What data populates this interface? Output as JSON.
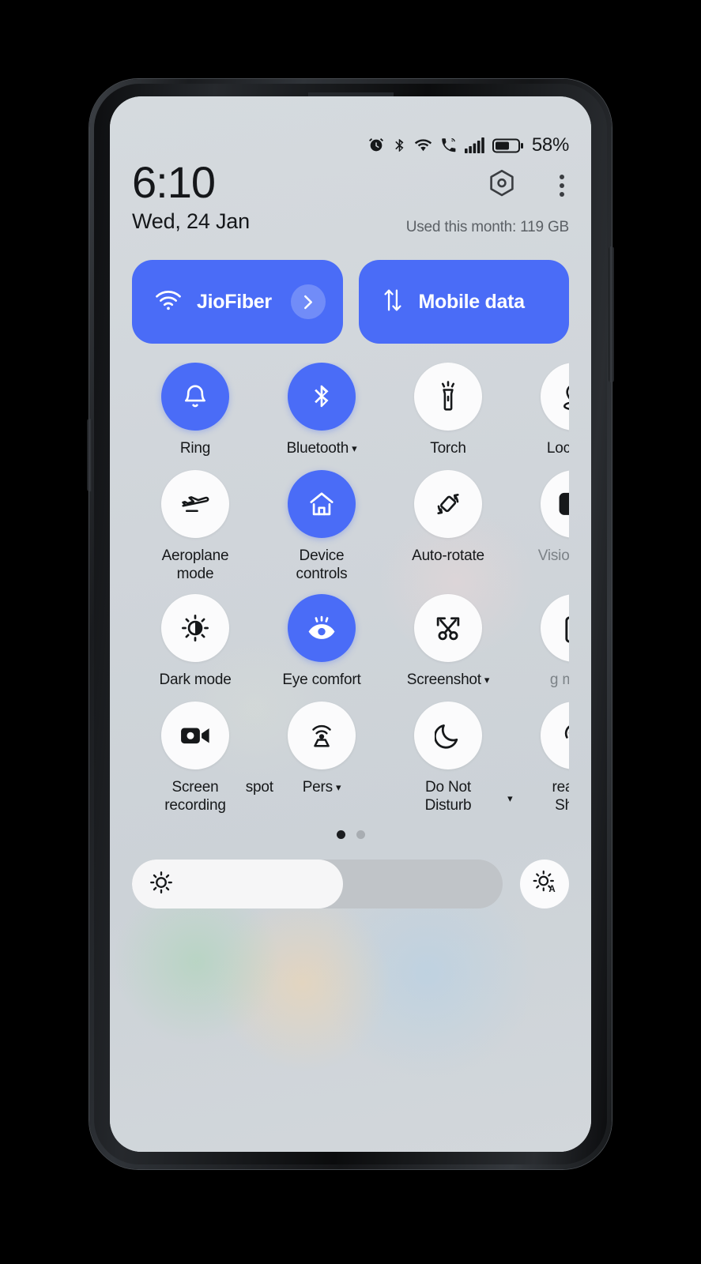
{
  "statusbar": {
    "icons": [
      "alarm-icon",
      "bluetooth-icon",
      "wifi-icon",
      "call-wifi-icon",
      "signal-icon",
      "battery-icon"
    ],
    "battery_percent": "58%"
  },
  "header": {
    "time": "6:10",
    "date": "Wed, 24 Jan",
    "settings_icon": "hex-gear-icon",
    "overflow_icon": "three-dot-menu-icon",
    "data_usage": "Used this month: 119 GB"
  },
  "connectivity": [
    {
      "label": "JioFiber",
      "icon": "wifi-icon",
      "active": true,
      "has_chevron": true
    },
    {
      "label": "Mobile data",
      "icon": "data-transfer-icon",
      "active": true,
      "has_chevron": false
    }
  ],
  "tiles": [
    {
      "label": "Ring",
      "icon": "bell-icon",
      "active": true,
      "caret": false
    },
    {
      "label": "Bluetooth",
      "icon": "bluetooth-icon",
      "active": true,
      "caret": true
    },
    {
      "label": "Torch",
      "icon": "flashlight-icon",
      "active": false,
      "caret": false
    },
    {
      "label": "Location",
      "icon": "location-pin-icon",
      "active": false,
      "caret": false
    },
    {
      "label": "Aeroplane\nmode",
      "icon": "airplane-icon",
      "active": false,
      "caret": false
    },
    {
      "label": "Device\ncontrols",
      "icon": "home-icon",
      "active": true,
      "caret": false
    },
    {
      "label": "Auto-rotate",
      "icon": "auto-rotate-icon",
      "active": false,
      "caret": false
    },
    {
      "label": "Vision Engi",
      "icon": "vision-engine-icon",
      "active": false,
      "caret": false,
      "clipped": true
    },
    {
      "label": "Dark mode",
      "icon": "dark-mode-icon",
      "active": false,
      "caret": false
    },
    {
      "label": "Eye comfort",
      "icon": "eye-icon",
      "active": true,
      "caret": false
    },
    {
      "label": "Screenshot",
      "icon": "screenshot-icon",
      "active": false,
      "caret": true
    },
    {
      "label": "ɡ mode",
      "icon": "battery-saver-icon",
      "active": false,
      "caret": false,
      "clipped": true
    },
    {
      "label": "Screen\nrecording",
      "icon": "video-camera-icon",
      "active": false,
      "caret": false
    },
    {
      "label": "Pers",
      "icon": "hotspot-icon",
      "active": false,
      "caret": true,
      "clipped": true
    },
    {
      "label": "Do Not\nDisturb",
      "icon": "moon-icon",
      "active": false,
      "caret": false
    },
    {
      "label": "realme\nShare",
      "icon": "broadcast-icon",
      "active": false,
      "caret": false
    }
  ],
  "ghost_labels": {
    "hotspot_fragment": "spot",
    "saving_fragment": "P"
  },
  "pagination": {
    "total": 2,
    "active_index": 0
  },
  "brightness": {
    "level_percent": 57,
    "slider_icon": "sun-icon",
    "auto_icon": "sun-auto-icon"
  },
  "colors": {
    "accent": "#4a6cf7",
    "tile_off": "#fbfbfc",
    "text": "#16181a",
    "muted": "#5c6166"
  }
}
